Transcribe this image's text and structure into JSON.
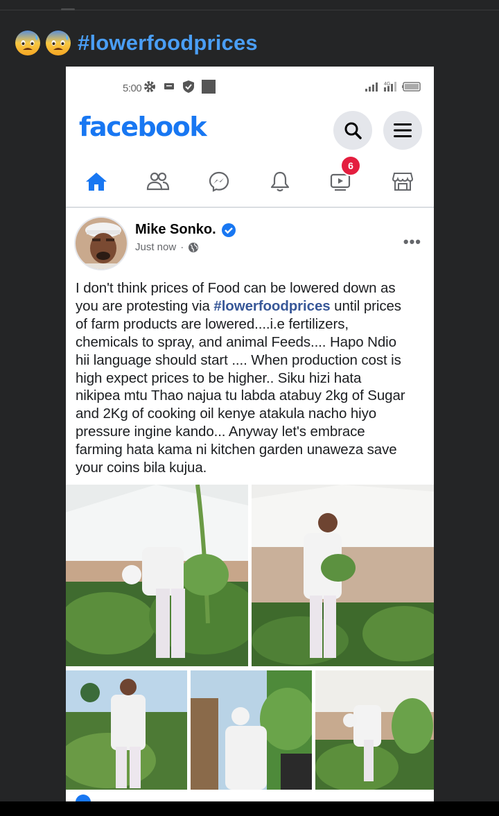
{
  "post": {
    "emojis": [
      "anxious-face-with-sweat",
      "anxious-face-with-sweat"
    ],
    "hashtag": "#lowerfoodprices"
  },
  "screenshot": {
    "status_bar": {
      "time": "5:00"
    },
    "header": {
      "logo_text": "facebook"
    },
    "nav": {
      "notification_badge": "6"
    },
    "post": {
      "author": "Mike Sonko.",
      "timestamp": "Just now",
      "separator": "·",
      "text_before_tag": "I don't think  prices of Food can be lowered down as\nyou are protesting via ",
      "tag": "#lowerfoodprices",
      "text_after_tag": " until prices\nof farm products are lowered....i.e fertilizers,\nchemicals to spray, and animal Feeds.... Hapo Ndio\nhii language should start .... When production cost is\nhigh expect prices to be higher.. Siku hizi hata\nnikipea mtu Thao najua tu labda atabuy 2kg of Sugar\nand 2Kg of cooking oil kenye atakula nacho hiyo\npressure ingine kando... Anyway let's embrace\nfarming hata kama ni kitchen garden unaweza save\nyour coins bila kujua."
    }
  },
  "colors": {
    "hashtag_blue": "#4a9ef5",
    "facebook_blue": "#1877f2",
    "badge_red": "#e41e3f",
    "link_blue": "#385898"
  }
}
